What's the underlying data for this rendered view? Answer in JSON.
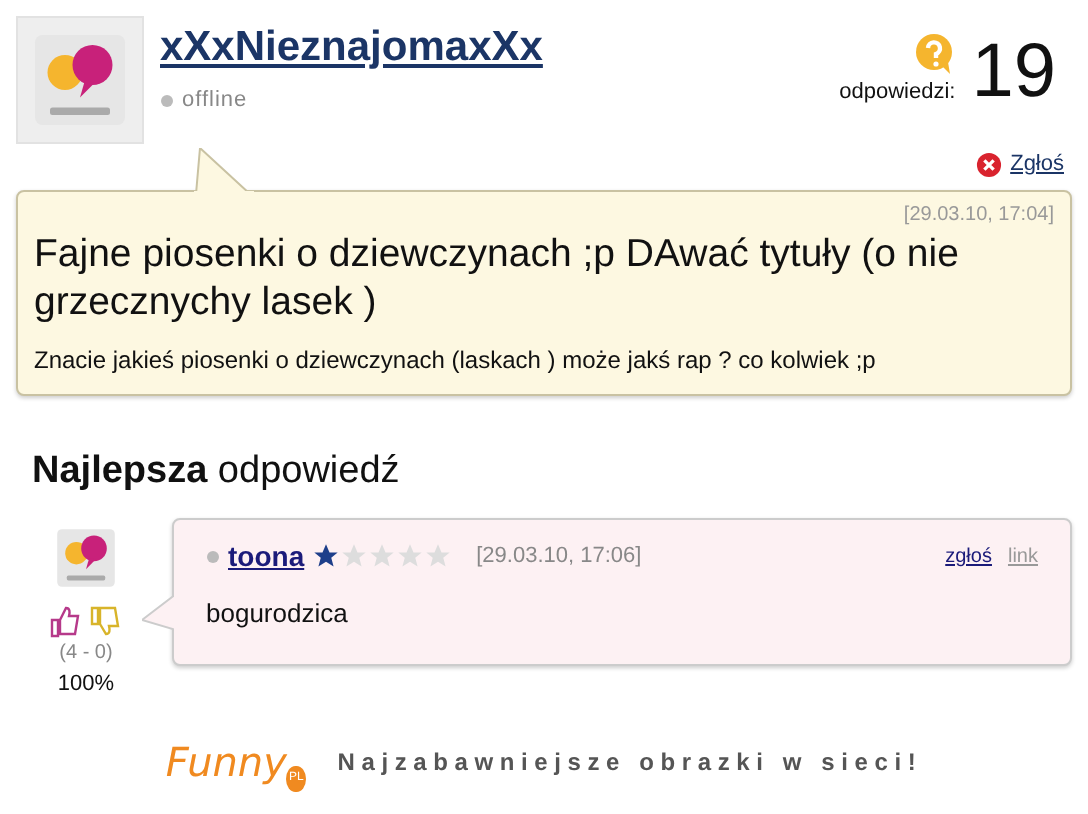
{
  "question": {
    "author": "xXxNieznajomaxXx",
    "status": "offline",
    "answers_label": "odpowiedzi:",
    "answers_count": "19",
    "report": "Zgłoś",
    "date": "[29.03.10, 17:04]",
    "title": "Fajne piosenki o dziewczynach ;p DAwać tytuły (o nie grzecznychy lasek )",
    "body": "Znacie jakieś piosenki o dziewczynach (laskach ) może jakś rap ? co kolwiek ;p"
  },
  "best_answer": {
    "heading": "**Najlepsza** odpowiedź",
    "author": "toona",
    "stars": 1,
    "date": "[29.03.10, 17:06]",
    "report": "zgłoś",
    "link": "link",
    "body": "bogurodzica",
    "votes": "(4 - 0)",
    "percent": "100%"
  },
  "footer": {
    "logo": "Funny",
    "logo_badge": "PL",
    "tagline": "Najzabawniejsze obrazki w sieci!"
  }
}
